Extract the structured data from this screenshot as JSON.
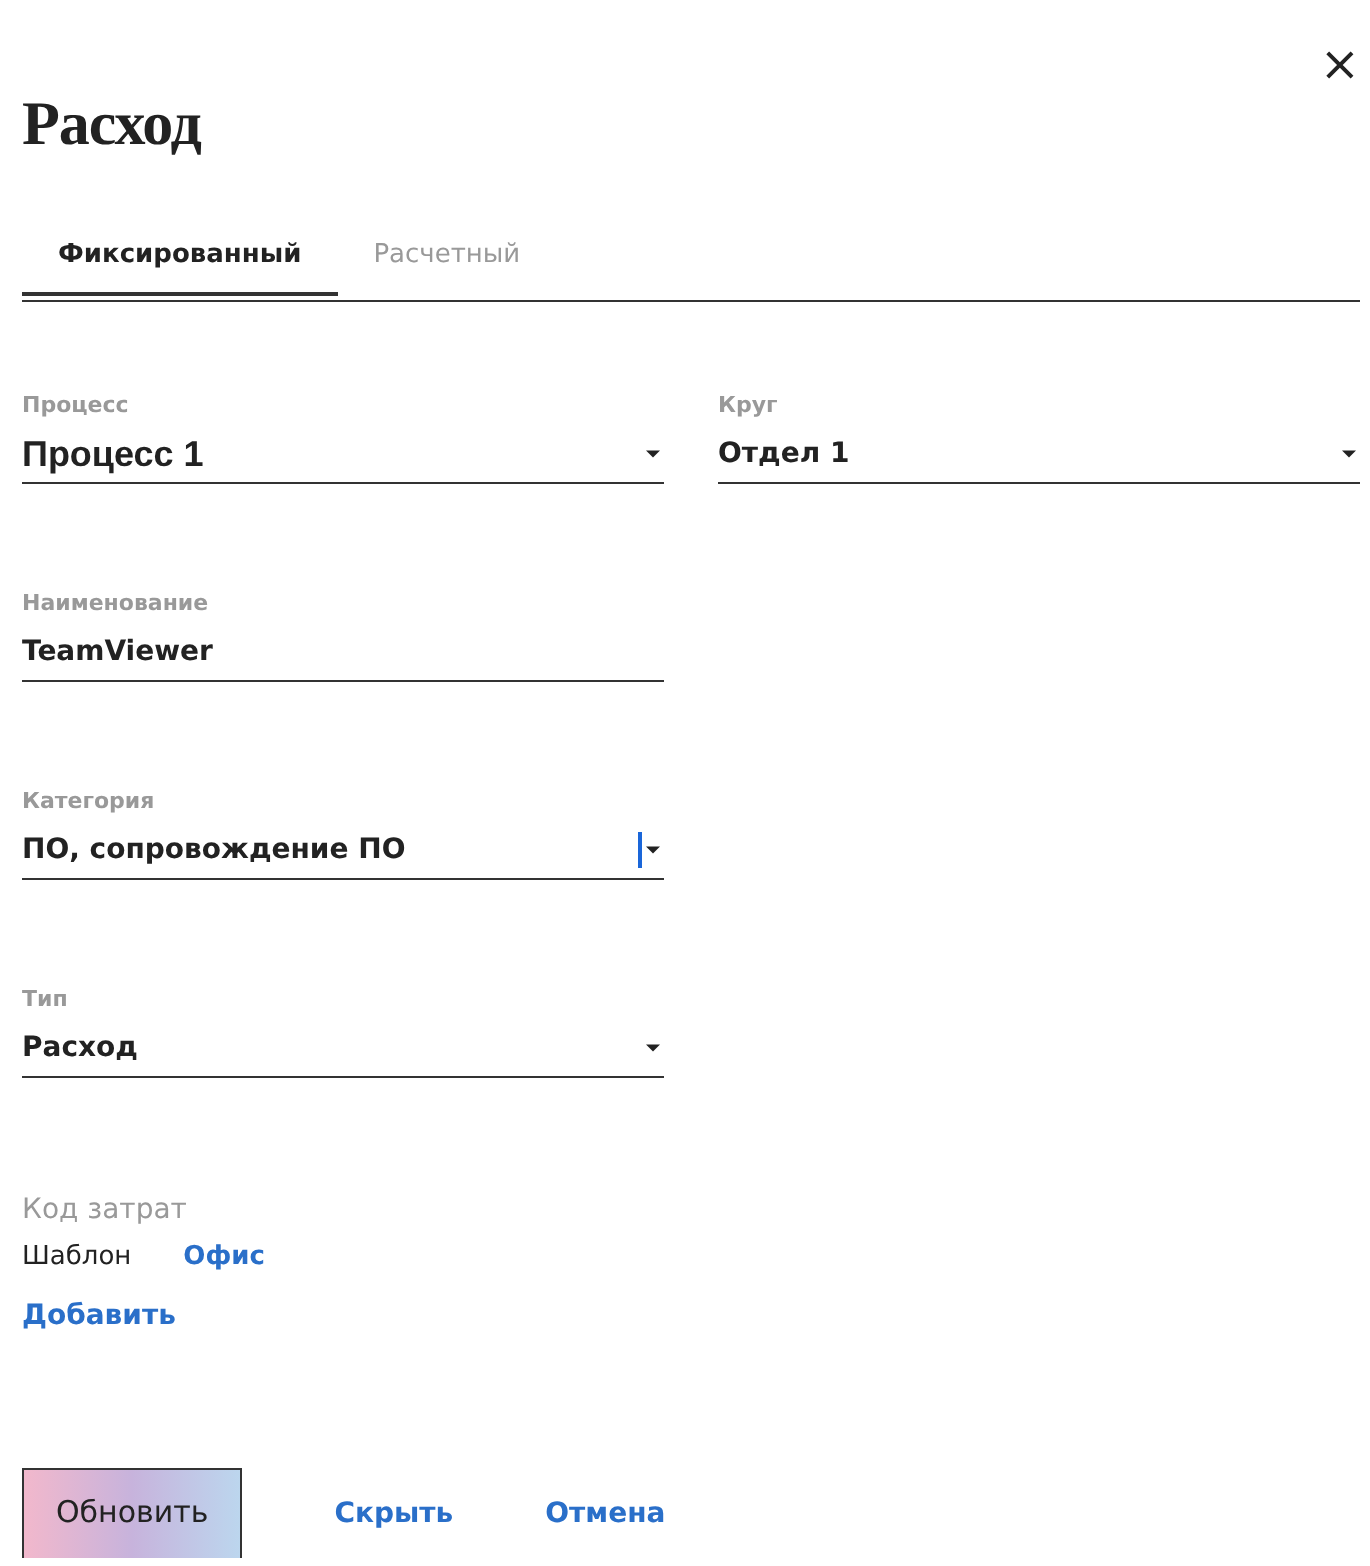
{
  "close": "×",
  "title": "Расход",
  "tabs": [
    {
      "label": "Фиксированный",
      "selected": true
    },
    {
      "label": "Расчетный",
      "selected": false
    }
  ],
  "field_rows": [
    [
      {
        "kind": "select",
        "label": "Процесс",
        "value": "Процесс 1",
        "focused": false
      },
      {
        "kind": "select",
        "label": "Круг",
        "value": "Отдел 1",
        "focused": false
      }
    ],
    [
      {
        "kind": "text",
        "label": "Наименование",
        "value": "TeamViewer",
        "focused": false
      }
    ],
    [
      {
        "kind": "select",
        "label": "Категория",
        "value": "ПО, сопровождение ПО",
        "focused": true
      }
    ],
    [
      {
        "kind": "select",
        "label": "Тип",
        "value": "Расход",
        "focused": false
      }
    ]
  ],
  "cost_code": {
    "label": "Код затрат",
    "name": "Шаблон",
    "link": "Офис",
    "add": "Добавить"
  },
  "buttons": [
    {
      "kind": "primary",
      "label": "Обновить"
    },
    {
      "kind": "link",
      "label": "Скрыть"
    },
    {
      "kind": "link",
      "label": "Отмена"
    }
  ]
}
